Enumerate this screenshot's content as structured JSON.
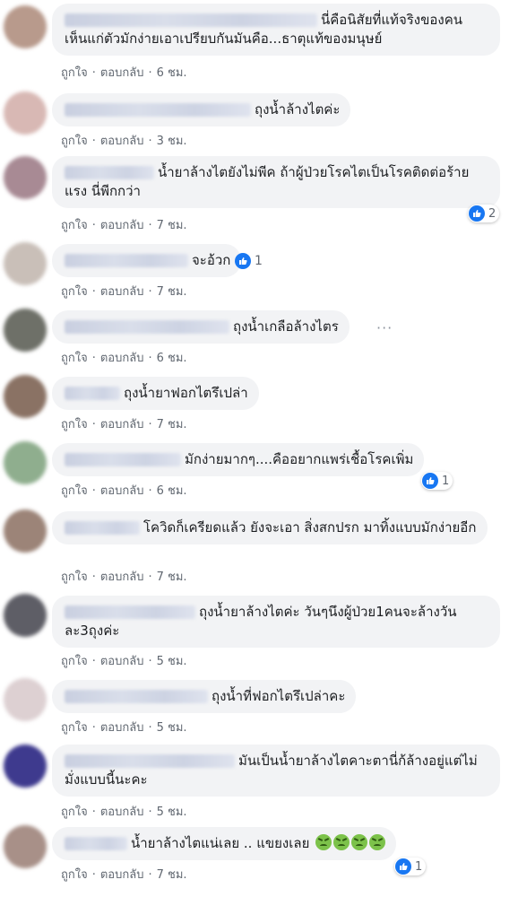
{
  "actions": {
    "like": "ถูกใจ",
    "reply": "ตอบกลับ",
    "dot": "·"
  },
  "comments": [
    {
      "text": "นี่คือนิสัยที่แท้จริงของคน เห็นแก่ตัวมักง่ายเอาเปรียบกันมันคือ...ธาตุแท้ของมนุษย์",
      "time": "6 ชม.",
      "avatar_color": "#b89a8c"
    },
    {
      "text": "ถุงน้ำล้างไตค่ะ",
      "time": "3 ชม.",
      "avatar_color": "#d8b8b4"
    },
    {
      "text": "น้ำยาล้างไตยังไม่พีค ถ้าผู้ป่วยโรคไตเป็นโรคติดต่อร้ายแรง นี่พีกกว่า",
      "time": "7 ชม.",
      "avatar_color": "#a88a94",
      "reactions": "2"
    },
    {
      "text": "จะอ้วก",
      "time": "7 ชม.",
      "avatar_color": "#c9bfb8",
      "inline_reactions": "1"
    },
    {
      "text": "ถุงน้ำเกลือล้างไตร",
      "time": "6 ชม.",
      "avatar_color": "#6e7068"
    },
    {
      "text": "ถุงน้ำยาฟอกไตรึเปล่า",
      "time": "7 ชม.",
      "avatar_color": "#8a7264"
    },
    {
      "text": "มักง่ายมากๆ....คืออยากแพร่เชื้อโรคเพิ่ม",
      "time": "6 ชม.",
      "avatar_color": "#8fae8e",
      "reactions": "1"
    },
    {
      "text": "โควิดก็เครียดแล้ว ยังจะเอา สิ่งสกปรก มาทิ้งแบบมักง่ายอีก",
      "time": "7 ชม.",
      "avatar_color": "#9c8478"
    },
    {
      "text": "ถุงน้ำยาล้างไตค่ะ วันๆนึงผู้ป่วย1คนจะล้างวันละ3ถุงค่ะ",
      "time": "5 ชม.",
      "avatar_color": "#5e5e66"
    },
    {
      "text": "ถุงน้ำที่ฟอกไตรึเปล่าคะ",
      "time": "5 ชม.",
      "avatar_color": "#ddd0d2"
    },
    {
      "text": "มันเป็นน้ำยาล้างไตคาะตานี่ก้ล้างอยู่แต่ไม่มั่งแบบนี้นะคะ",
      "time": "5 ชม.",
      "avatar_color": "#3e3a8e"
    },
    {
      "text": "น้ำยาล้างไตแน่เลย .. แขยงเลย",
      "time": "7 ชม.",
      "avatar_color": "#a89088",
      "reactions": "1",
      "emoji_count": 4
    }
  ]
}
